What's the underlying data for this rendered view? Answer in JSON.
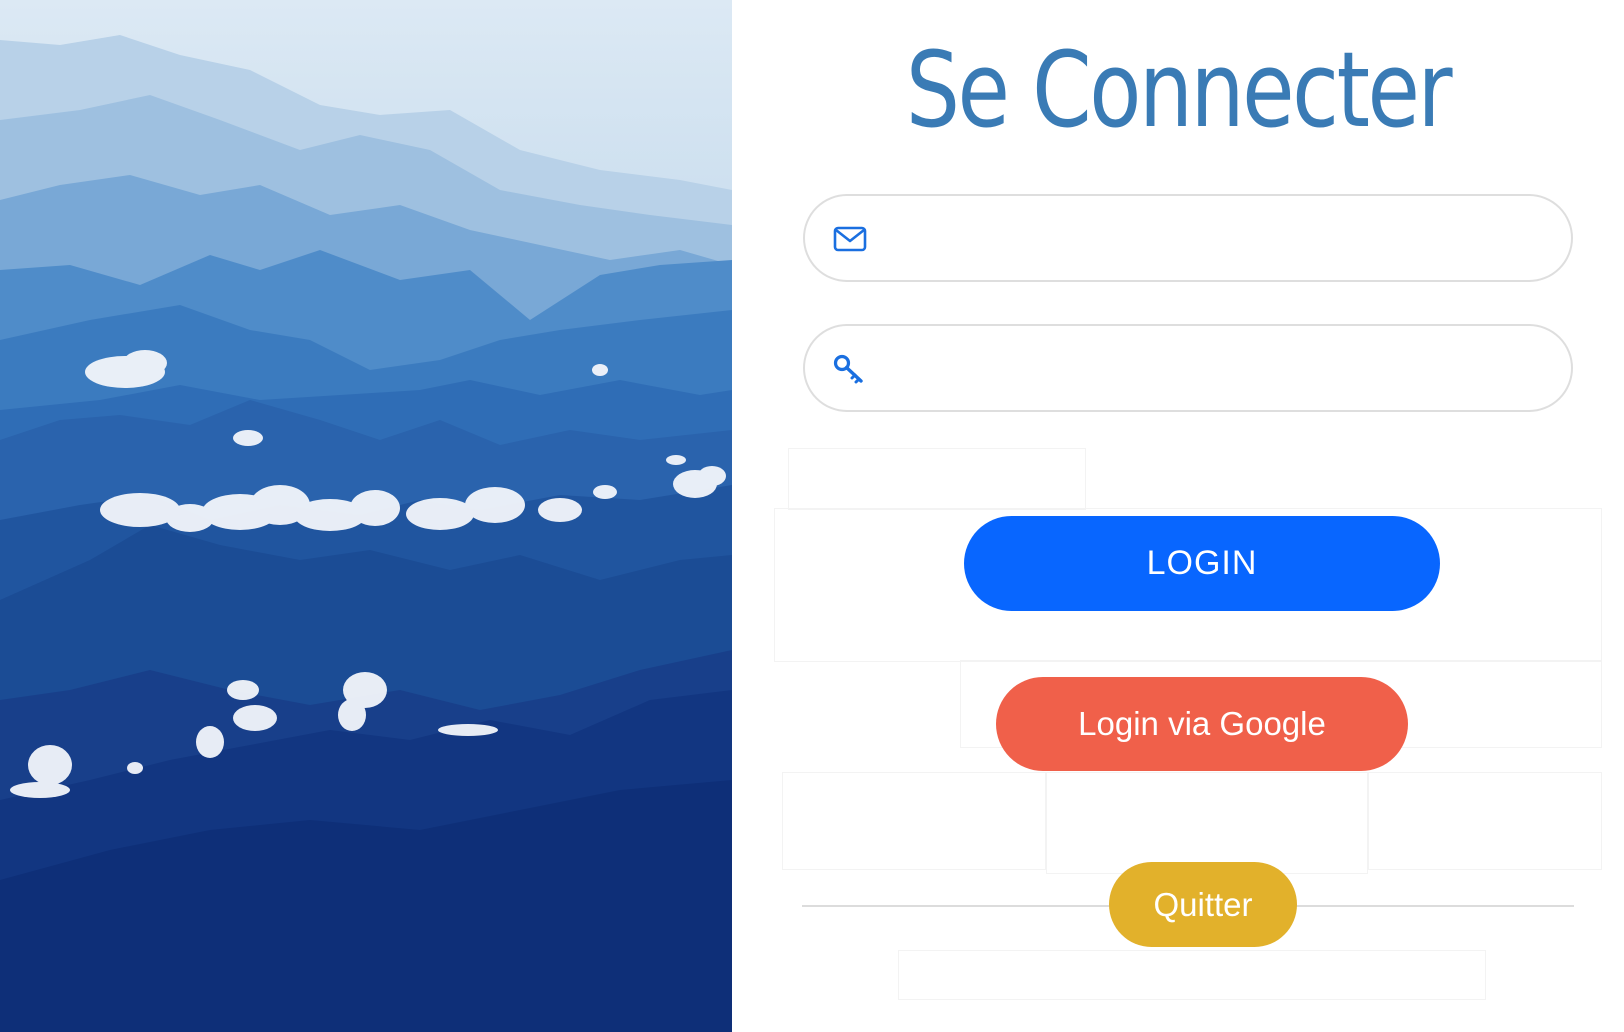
{
  "login_panel": {
    "title": "Se Connecter",
    "email_field": {
      "icon": "envelope-icon",
      "value": "",
      "placeholder": ""
    },
    "password_field": {
      "icon": "key-icon",
      "value": "",
      "placeholder": ""
    },
    "login_button": "LOGIN",
    "google_button": "Login via Google",
    "quit_button": "Quitter"
  },
  "hero_image": {
    "subject": "mountains-clouds"
  },
  "colors": {
    "title": "#3a7bb5",
    "login": "#0866ff",
    "google": "#f0604a",
    "quit": "#e2b12b",
    "field_border": "#dedede"
  }
}
